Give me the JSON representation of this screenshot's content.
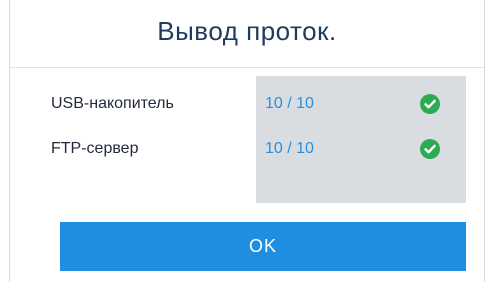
{
  "dialog": {
    "title": "Вывод проток.",
    "rows": [
      {
        "label": "USB-накопитель",
        "value": "10 / 10",
        "status_icon": "check-circle-icon"
      },
      {
        "label": "FTP-сервер",
        "value": "10 / 10",
        "status_icon": "check-circle-icon"
      }
    ],
    "ok_label": "OK"
  },
  "colors": {
    "title_text": "#1f3b5c",
    "value_text": "#2a8fd8",
    "status_panel": "#d9dde2",
    "success_green": "#2eaa53",
    "button_bg": "#1f8ee0",
    "button_text": "#ffffff"
  }
}
